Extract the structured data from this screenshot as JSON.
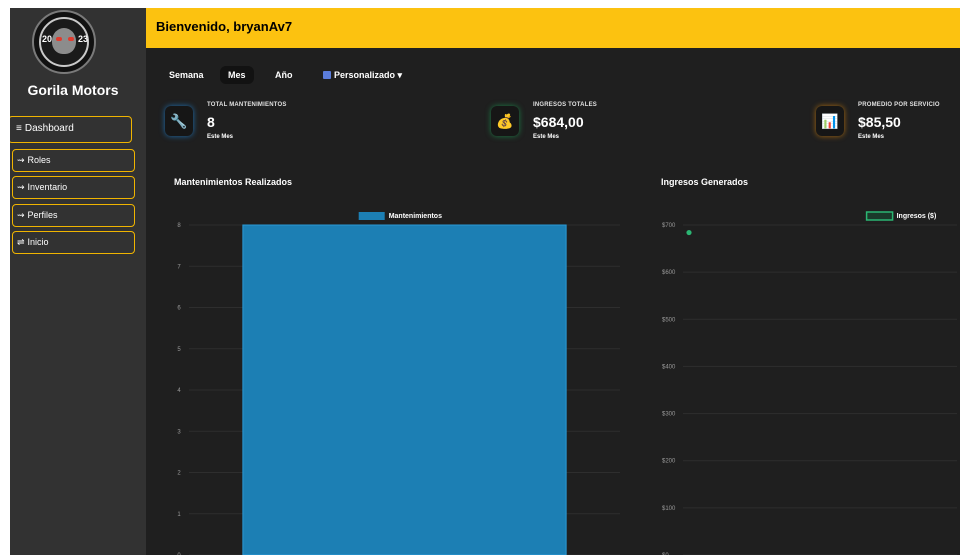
{
  "sidebar": {
    "brand": "Gorila Motors",
    "logo_numbers": [
      "20",
      "23"
    ],
    "dashboard": {
      "glyph": "≡",
      "label": "Dashboard"
    },
    "items": [
      {
        "glyph": "⇝",
        "label": "Roles"
      },
      {
        "glyph": "⇝",
        "label": "Inventario"
      },
      {
        "glyph": "⇝",
        "label": "Perfiles"
      },
      {
        "glyph": "⇌",
        "label": "Inicio"
      }
    ]
  },
  "header": {
    "welcome": "Bienvenido, bryanAv7"
  },
  "tabs": [
    {
      "label": "Semana",
      "active": false
    },
    {
      "label": "Mes",
      "active": true
    },
    {
      "label": "Año",
      "active": false
    },
    {
      "label": "Personalizado ▾",
      "active": false,
      "icon": "calendar-icon"
    }
  ],
  "stats": [
    {
      "label": "TOTAL MANTENIMIENTOS",
      "value": "8",
      "sub": "Este Mes",
      "icon": "wrench-icon",
      "glow": "#1f6fb0"
    },
    {
      "label": "INGRESOS TOTALES",
      "value": "$684,00",
      "sub": "Este Mes",
      "icon": "money-bag-icon",
      "glow": "#1c7a45"
    },
    {
      "label": "PROMEDIO POR SERVICIO",
      "value": "$85,50",
      "sub": "Este Mes",
      "icon": "bar-chart-icon",
      "glow": "#a86a10"
    }
  ],
  "chart_titles": [
    "Mantenimientos Realizados",
    "Ingresos Generados"
  ],
  "chart_data": [
    {
      "type": "bar",
      "categories": [
        ""
      ],
      "series": [
        {
          "name": "Mantenimientos",
          "values": [
            8
          ],
          "color": "#1c7fb4"
        }
      ],
      "yticks": [
        "0",
        "1",
        "2",
        "3",
        "4",
        "5",
        "6",
        "7",
        "8"
      ],
      "ylim": [
        0,
        8
      ],
      "legend": "top"
    },
    {
      "type": "line",
      "x": [
        0
      ],
      "series": [
        {
          "name": "Ingresos ($)",
          "values": [
            684
          ],
          "color": "#2bb673"
        }
      ],
      "yticks": [
        "$0",
        "$100",
        "$200",
        "$300",
        "$400",
        "$500",
        "$600",
        "$700"
      ],
      "ylim": [
        0,
        700
      ],
      "legend": "top-right"
    }
  ]
}
